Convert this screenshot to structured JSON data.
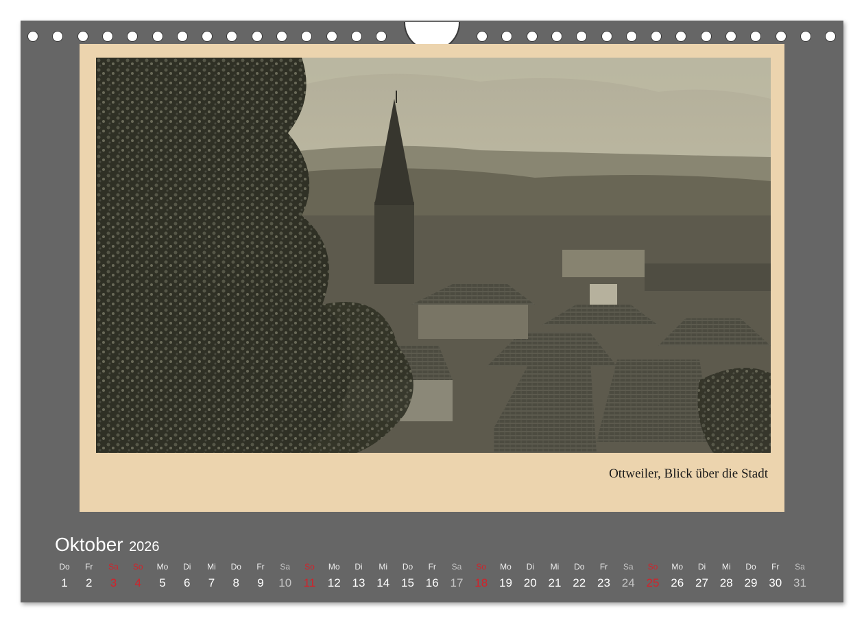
{
  "caption": "Ottweiler, Blick über die Stadt",
  "calendar": {
    "month": "Oktober",
    "year": "2026",
    "days": [
      {
        "wd": "Do",
        "d": "1",
        "kind": "normal"
      },
      {
        "wd": "Fr",
        "d": "2",
        "kind": "normal"
      },
      {
        "wd": "Sa",
        "d": "3",
        "kind": "holiday"
      },
      {
        "wd": "So",
        "d": "4",
        "kind": "holiday"
      },
      {
        "wd": "Mo",
        "d": "5",
        "kind": "normal"
      },
      {
        "wd": "Di",
        "d": "6",
        "kind": "normal"
      },
      {
        "wd": "Mi",
        "d": "7",
        "kind": "normal"
      },
      {
        "wd": "Do",
        "d": "8",
        "kind": "normal"
      },
      {
        "wd": "Fr",
        "d": "9",
        "kind": "normal"
      },
      {
        "wd": "Sa",
        "d": "10",
        "kind": "saturday"
      },
      {
        "wd": "So",
        "d": "11",
        "kind": "holiday"
      },
      {
        "wd": "Mo",
        "d": "12",
        "kind": "normal"
      },
      {
        "wd": "Di",
        "d": "13",
        "kind": "normal"
      },
      {
        "wd": "Mi",
        "d": "14",
        "kind": "normal"
      },
      {
        "wd": "Do",
        "d": "15",
        "kind": "normal"
      },
      {
        "wd": "Fr",
        "d": "16",
        "kind": "normal"
      },
      {
        "wd": "Sa",
        "d": "17",
        "kind": "saturday"
      },
      {
        "wd": "So",
        "d": "18",
        "kind": "holiday"
      },
      {
        "wd": "Mo",
        "d": "19",
        "kind": "normal"
      },
      {
        "wd": "Di",
        "d": "20",
        "kind": "normal"
      },
      {
        "wd": "Mi",
        "d": "21",
        "kind": "normal"
      },
      {
        "wd": "Do",
        "d": "22",
        "kind": "normal"
      },
      {
        "wd": "Fr",
        "d": "23",
        "kind": "normal"
      },
      {
        "wd": "Sa",
        "d": "24",
        "kind": "saturday"
      },
      {
        "wd": "So",
        "d": "25",
        "kind": "holiday"
      },
      {
        "wd": "Mo",
        "d": "26",
        "kind": "normal"
      },
      {
        "wd": "Di",
        "d": "27",
        "kind": "normal"
      },
      {
        "wd": "Mi",
        "d": "28",
        "kind": "normal"
      },
      {
        "wd": "Do",
        "d": "29",
        "kind": "normal"
      },
      {
        "wd": "Fr",
        "d": "30",
        "kind": "normal"
      },
      {
        "wd": "Sa",
        "d": "31",
        "kind": "saturday"
      }
    ]
  },
  "colors": {
    "frame": "#666666",
    "mat": "#ecd4ae",
    "holiday": "#d2222a",
    "saturday": "#c4c4c4"
  }
}
